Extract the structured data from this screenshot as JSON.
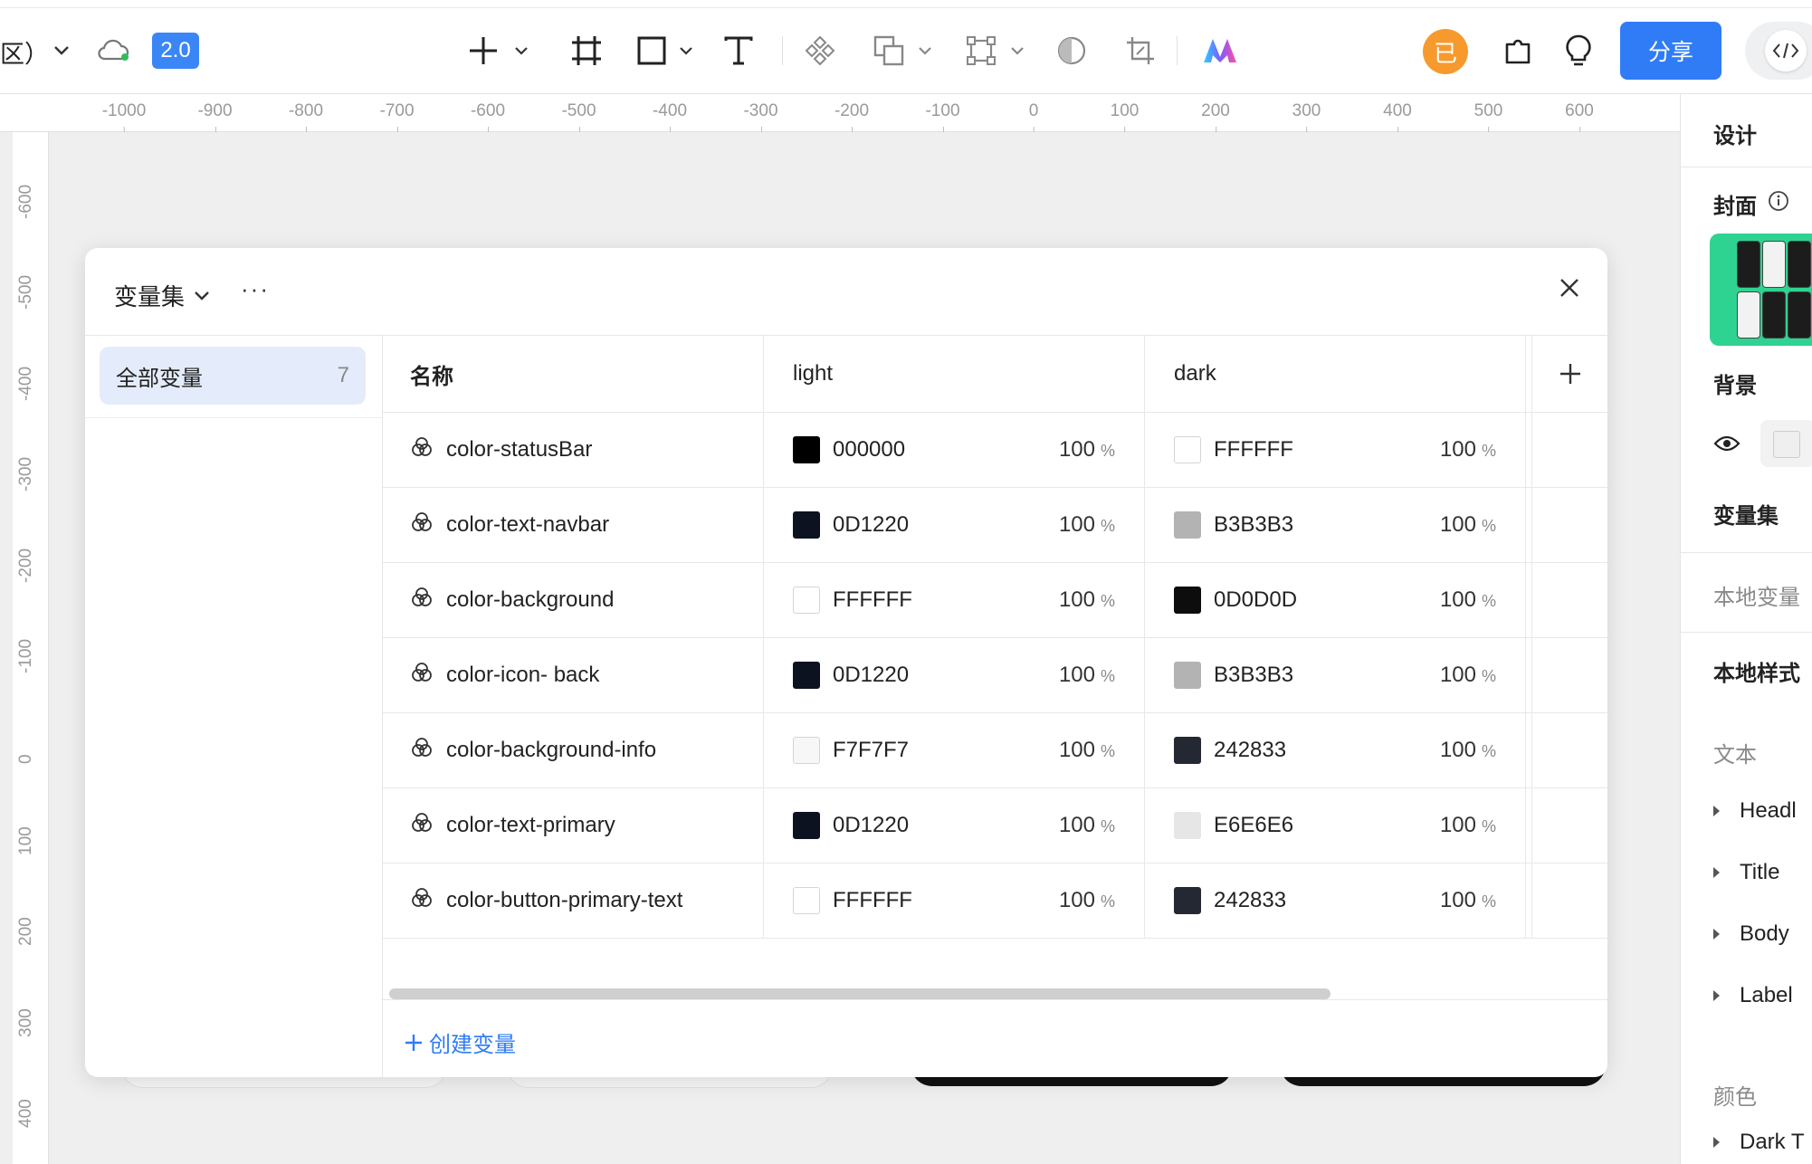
{
  "toolbar": {
    "scope_text": "区）",
    "version": "2.0",
    "avatar_text": "已",
    "share_label": "分享"
  },
  "ruler": {
    "h_ticks": [
      "-1000",
      "-900",
      "-800",
      "-700",
      "-600",
      "-500",
      "-400",
      "-300",
      "-200",
      "-100",
      "0",
      "100",
      "200",
      "300",
      "400",
      "500",
      "600"
    ],
    "v_ticks": [
      "-600",
      "-500",
      "-400",
      "-300",
      "-200",
      "-100",
      "0",
      "100",
      "200",
      "300",
      "400"
    ]
  },
  "dialog": {
    "title": "变量集",
    "more": "···",
    "sidebar": {
      "label": "全部变量",
      "count": "7"
    },
    "columns": {
      "name": "名称",
      "light": "light",
      "dark": "dark"
    },
    "rows": [
      {
        "name": "color-statusBar",
        "light_hex": "000000",
        "light_color": "#000000",
        "light_pct": "100",
        "dark_hex": "FFFFFF",
        "dark_color": "#FFFFFF",
        "dark_pct": "100"
      },
      {
        "name": "color-text-navbar",
        "light_hex": "0D1220",
        "light_color": "#0D1220",
        "light_pct": "100",
        "dark_hex": "B3B3B3",
        "dark_color": "#B3B3B3",
        "dark_pct": "100"
      },
      {
        "name": "color-background",
        "light_hex": "FFFFFF",
        "light_color": "#FFFFFF",
        "light_pct": "100",
        "dark_hex": "0D0D0D",
        "dark_color": "#0D0D0D",
        "dark_pct": "100"
      },
      {
        "name": "color-icon- back",
        "light_hex": "0D1220",
        "light_color": "#0D1220",
        "light_pct": "100",
        "dark_hex": "B3B3B3",
        "dark_color": "#B3B3B3",
        "dark_pct": "100"
      },
      {
        "name": "color-background-info",
        "light_hex": "F7F7F7",
        "light_color": "#F7F7F7",
        "light_pct": "100",
        "dark_hex": "242833",
        "dark_color": "#242833",
        "dark_pct": "100"
      },
      {
        "name": "color-text-primary",
        "light_hex": "0D1220",
        "light_color": "#0D1220",
        "light_pct": "100",
        "dark_hex": "E6E6E6",
        "dark_color": "#E6E6E6",
        "dark_pct": "100"
      },
      {
        "name": "color-button-primary-text",
        "light_hex": "FFFFFF",
        "light_color": "#FFFFFF",
        "light_pct": "100",
        "dark_hex": "242833",
        "dark_color": "#242833",
        "dark_pct": "100"
      }
    ],
    "percent_sign": "%",
    "create_label": "创建变量"
  },
  "right_panel": {
    "design_tab": "设计",
    "cover": "封面",
    "background": "背景",
    "variable_set": "变量集",
    "local_vars": "本地变量",
    "local_styles": "本地样式",
    "text": "文本",
    "styles": [
      "Headl",
      "Title",
      "Body",
      "Label"
    ],
    "color": "颜色",
    "color_item": "Dark T"
  },
  "colors": {
    "accent": "#2F7CF6",
    "version_badge": "#3B86F7",
    "avatar": "#F79A2E",
    "sidebar_selected": "#E4ECFB",
    "cover_green": "#2FD391"
  }
}
